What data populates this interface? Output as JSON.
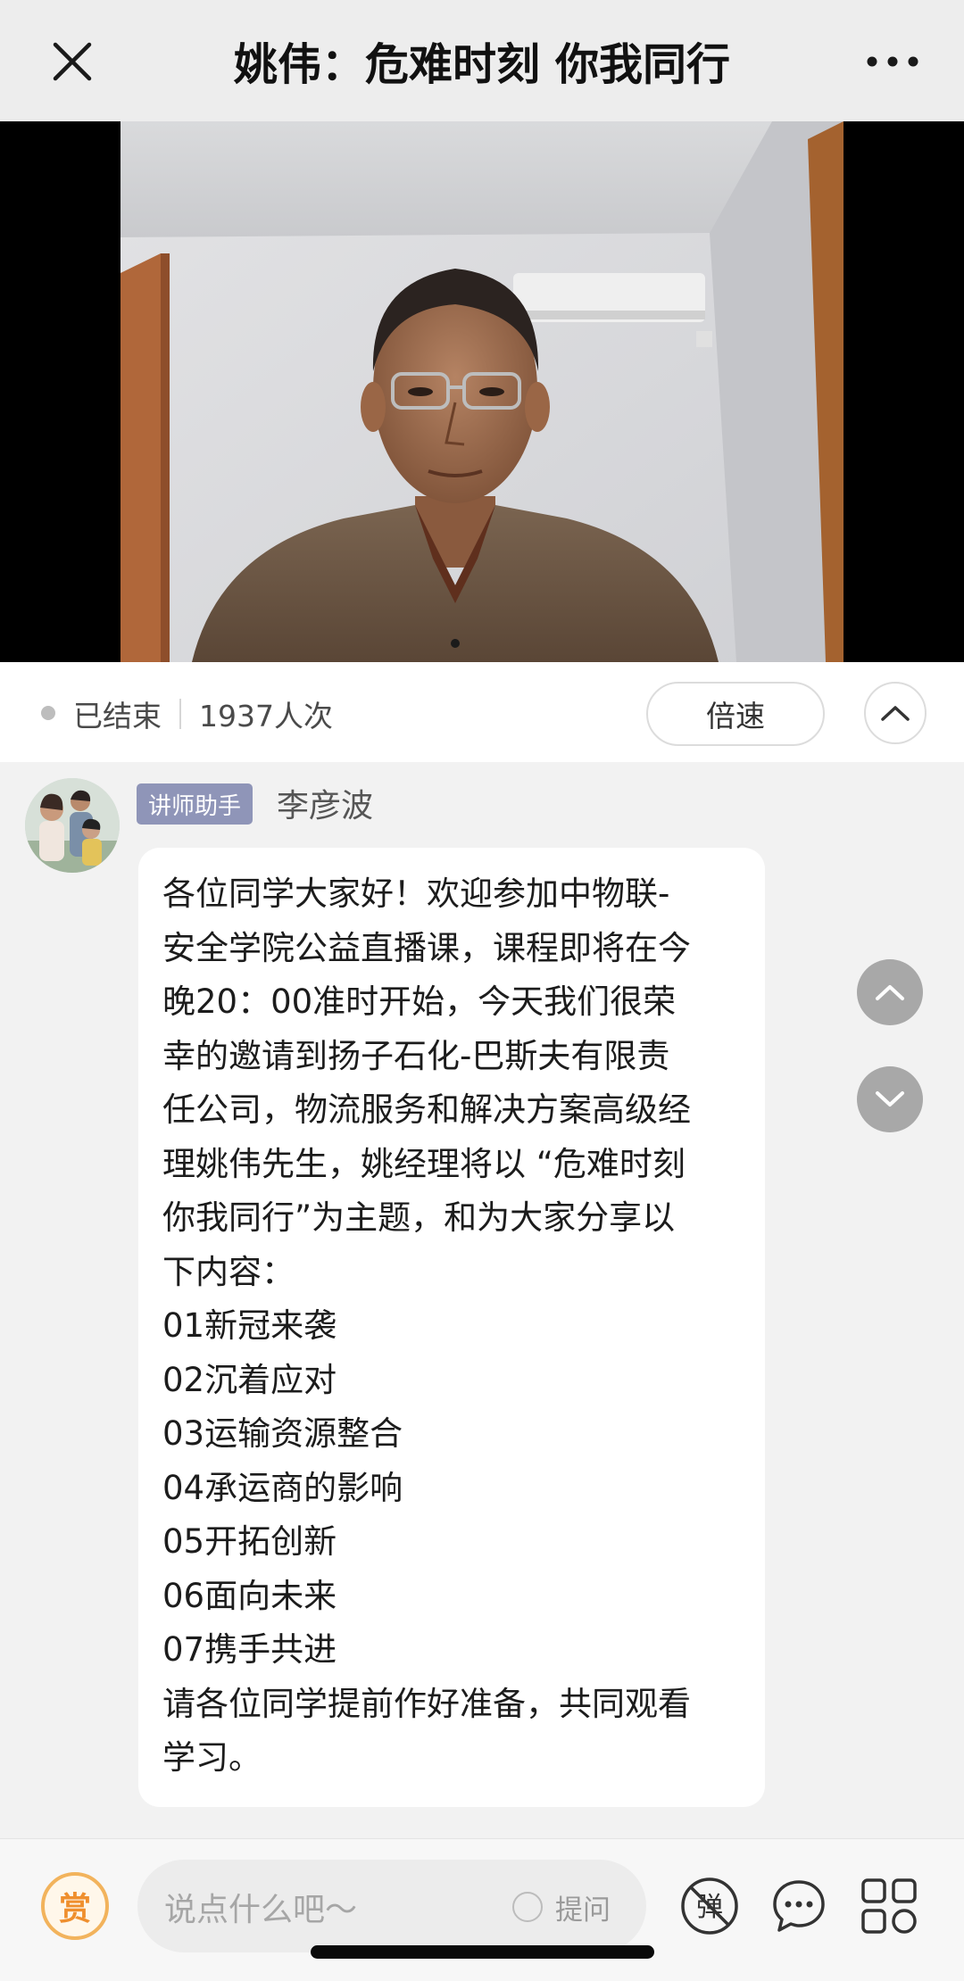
{
  "navbar": {
    "title": "姚伟：危难时刻 你我同行",
    "close_icon": "close-icon",
    "more_icon": "more-horizontal-icon"
  },
  "video": {
    "description_icon": "presenter-video-feed"
  },
  "status": {
    "state": "已结束",
    "views": "1937人次",
    "speed_label": "倍速",
    "collapse_icon": "chevron-up-icon"
  },
  "message": {
    "role": "讲师助手",
    "sender": "李彦波",
    "lines": [
      "各位同学大家好！欢迎参加中物联-",
      "安全学院公益直播课，课程即将在今",
      "晚20：00准时开始，今天我们很荣",
      "幸的邀请到扬子石化-巴斯夫有限责",
      "任公司，物流服务和解决方案高级经",
      "理姚伟先生，姚经理将以 “危难时刻",
      "你我同行”为主题，和为大家分享以",
      "下内容：",
      "01新冠来袭",
      "02沉着应对",
      "03运输资源整合",
      "04承运商的影响",
      "05开拓创新",
      "06面向未来",
      "07携手共进",
      "请各位同学提前作好准备，共同观看",
      "学习。"
    ]
  },
  "bottom": {
    "reward_label": "赏",
    "input_placeholder": "说点什么吧～",
    "ask_label": "提问",
    "danmu_label": "弹"
  },
  "colors": {
    "nav_bg": "#ededed",
    "badge": "#8f95b8",
    "reward": "#ef8f2e",
    "chat_bg": "#f2f2f2"
  }
}
